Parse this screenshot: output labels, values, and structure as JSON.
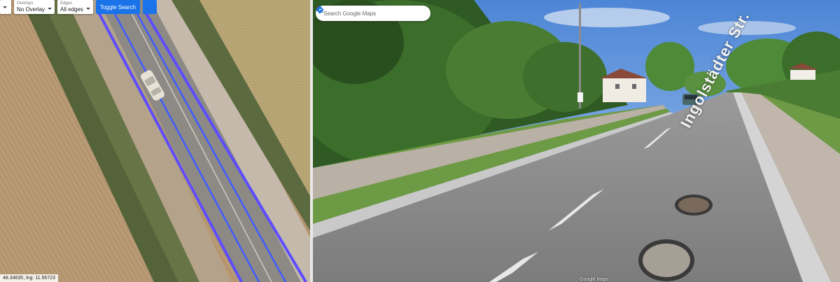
{
  "toolbar": {
    "overlay": {
      "label": "Overlays",
      "value": "No Overlay"
    },
    "edges": {
      "label": "Edges",
      "value": "All edges"
    },
    "toggle_search_label": "Toggle Search",
    "filter_icon": "filter-icon",
    "search_icon": "search-icon",
    "menu_caret_icon": "chevron-down-icon"
  },
  "map": {
    "coords_text": "48.34635, lng: 11.56723",
    "road_overlay_color": "#3f5bff"
  },
  "streetview": {
    "search_placeholder": "Search Google Maps",
    "search_icon": "search-icon",
    "directions_icon": "directions-icon",
    "street_sign_text": "Ingolstädter Str.",
    "watermark": "Google Maps"
  }
}
